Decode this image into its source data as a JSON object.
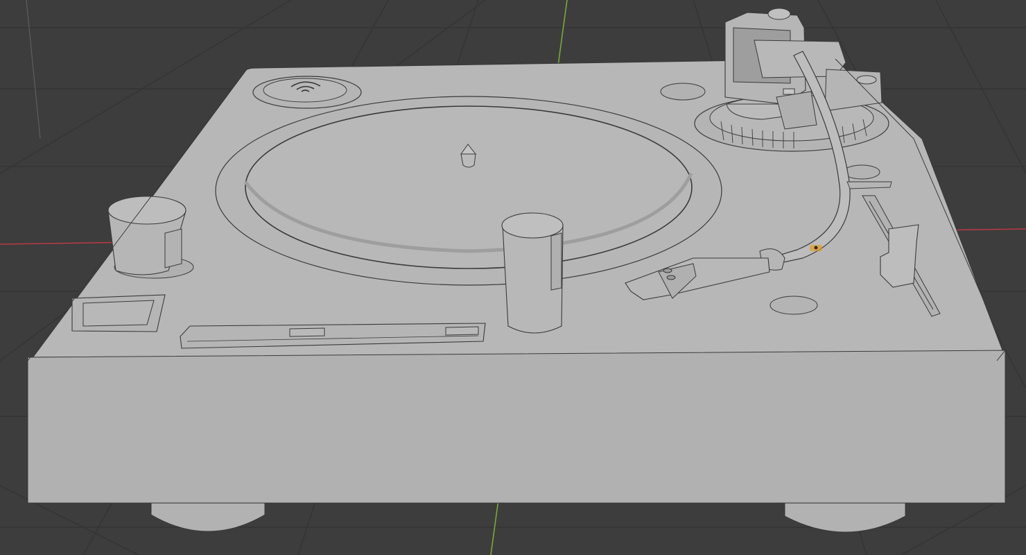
{
  "viewport": {
    "background_color": "#3d3d3d",
    "grid_color": "#333333",
    "x_axis_color": "#b53a44",
    "y_axis_color": "#7aa83a",
    "z_axis_color": "#6d6d6d",
    "model_color": "#b5b5b5",
    "edge_color": "#3a3a3a",
    "selection_color": "#e39a1e"
  },
  "scene": {
    "object_name": "turntable-model",
    "parts": [
      "platter",
      "spindle",
      "tone-arm",
      "headshell",
      "pitch-slider",
      "start-stop-button",
      "strobe-light",
      "rpm-buttons",
      "feet"
    ]
  }
}
